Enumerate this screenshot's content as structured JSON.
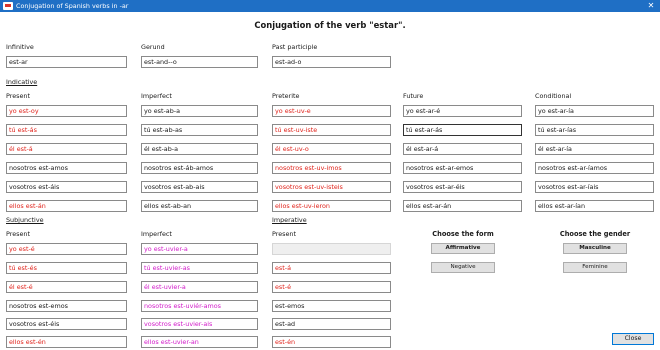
{
  "window": {
    "title": "Conjugation of Spanish verbs in -ar",
    "close_glyph": "✕"
  },
  "heading": "Conjugation of the verb \"estar\".",
  "nonfinite": {
    "infinitive_label": "Infinitive",
    "infinitive_value": "est-ar",
    "gerund_label": "Gerund",
    "gerund_value": "est-and--o",
    "participle_label": "Past participle",
    "participle_value": "est-ad-o"
  },
  "indicative": {
    "section_label": "Indicative",
    "present": {
      "label": "Present",
      "forms": [
        "yo est-oy",
        "tú est-ás",
        "él est-á",
        "nosotros est-amos",
        "vosotros est-áis",
        "ellos est-án"
      ]
    },
    "imperfect": {
      "label": "Imperfect",
      "forms": [
        "yo est-ab-a",
        "tú est-ab-as",
        "él est-ab-a",
        "nosotros est-áb-amos",
        "vosotros est-ab-ais",
        "ellos est-ab-an"
      ]
    },
    "preterite": {
      "label": "Preterite",
      "forms": [
        "yo est-uv-e",
        "tú est-uv-iste",
        "él est-uv-o",
        "nosotros est-uv-imos",
        "vosotros est-uv-isteis",
        "ellos est-uv-ieron"
      ]
    },
    "future": {
      "label": "Future",
      "forms": [
        "yo est-ar-é",
        "tú est-ar-ás",
        "él est-ar-á",
        "nosotros est-ar-emos",
        "vosotros est-ar-éis",
        "ellos est-ar-án"
      ]
    },
    "conditional": {
      "label": "Conditional",
      "forms": [
        "yo est-ar-ía",
        "tú est-ar-ías",
        "él est-ar-ía",
        "nosotros est-ar-íamos",
        "vosotros est-ar-íais",
        "ellos est-ar-ían"
      ]
    }
  },
  "subjunctive": {
    "section_label": "Subjunctive",
    "present": {
      "label": "Present",
      "forms": [
        "yo est-é",
        "tú est-és",
        "él est-é",
        "nosotros est-emos",
        "vosotros est-éis",
        "ellos est-én"
      ]
    },
    "imperfect": {
      "label": "Imperfect",
      "forms": [
        "yo est-uvier-a",
        "tú est-uvier-as",
        "él est-uvier-a",
        "nosotros est-uviér-amos",
        "vosotros est-uvier-ais",
        "ellos est-uvier-an"
      ]
    }
  },
  "imperative": {
    "section_label": "Imperative",
    "present": {
      "label": "Present",
      "forms": [
        "",
        "est-á",
        "est-é",
        "est-emos",
        "est-ad",
        "est-én"
      ]
    }
  },
  "form_chooser": {
    "title": "Choose the form",
    "affirmative": "Affirmative",
    "negative": "Negative"
  },
  "gender_chooser": {
    "title": "Choose the gender",
    "masculine": "Masculine",
    "feminine": "Feminine"
  },
  "close_button": "Close",
  "colors": {
    "titlebar": "#1f6fc5",
    "irregular_red": "#e0231b",
    "irregular_pink": "#d21ac9"
  }
}
